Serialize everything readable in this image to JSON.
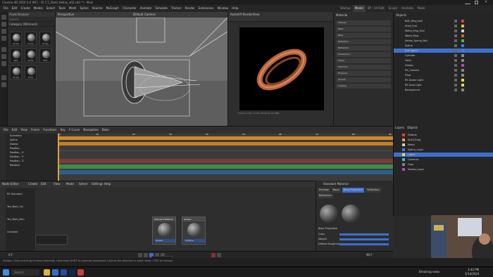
{
  "window": {
    "title": "Cinema 4D 2024.4.0 (RC) - [R 1.5_Shell_Helios_v02.c4d *] - Main"
  },
  "menu": [
    "File",
    "Edit",
    "Create",
    "Modes",
    "Select",
    "Tools",
    "Mesh",
    "Spline",
    "Volume",
    "MoGraph",
    "Character",
    "Animate",
    "Simulate",
    "Tracker",
    "Render",
    "Extensions",
    "Window",
    "Help"
  ],
  "modes": {
    "items": [
      "Startup",
      "Model",
      "BP - UV Edit",
      "Sculpt",
      "Animate",
      "Node"
    ],
    "active": "Model"
  },
  "asset_browser": {
    "title": "Asset Browser",
    "search_placeholder": "Search",
    "category": "Category (Wildcard)",
    "items": [
      "Screw",
      "Screw",
      "Hinge",
      "Nail",
      "Screw",
      "Bolt",
      "Screw",
      "Knob"
    ]
  },
  "viewport": {
    "label": "Perspective",
    "camera": "Default Camera"
  },
  "render_view": {
    "title": "Redshift RenderView",
    "status": "Frame: 0  2K1 / 8 48 / 00:00:02 (0.1MB)"
  },
  "material_attributes": {
    "title": "Material",
    "rows": [
      "Preview",
      "Basic",
      "Base",
      "Reflection",
      "Refraction",
      "Subsurface",
      "Sheen",
      "Thin Film",
      "Emission",
      "Overall",
      "Coating"
    ]
  },
  "object_manager": {
    "title": "Objects",
    "rows": [
      {
        "name": "Bolt_Ring_Null",
        "tag": "#e04040"
      },
      {
        "name": "Shell_Sub",
        "tag": "#e0c040"
      },
      {
        "name": "Metal_Ring_Null",
        "tag": "#d0d0d0"
      },
      {
        "name": "Wood_Ring",
        "tag": "#c07030"
      },
      {
        "name": "Helios_Spring_Null",
        "tag": "#40c040"
      },
      {
        "name": "Spline",
        "tag": "#4080e0"
      },
      {
        "name": "Sub Spline",
        "tag": "#4080e0"
      },
      {
        "name": "Cylinder",
        "tag": "#888888"
      },
      {
        "name": "Helix",
        "tag": "#888888"
      },
      {
        "name": "Sweep",
        "tag": "#c040c0"
      },
      {
        "name": "RS_Camera",
        "tag": "#888888"
      },
      {
        "name": "Floor",
        "tag": "#888888"
      },
      {
        "name": "RS Dome Light",
        "tag": "#e0e040"
      },
      {
        "name": "RS Area Light",
        "tag": "#e0e040"
      },
      {
        "name": "Background",
        "tag": "#888888"
      }
    ]
  },
  "timeline": {
    "title": "Timeline",
    "menu": [
      "File",
      "Edit",
      "View",
      "Frame",
      "Functions",
      "Key",
      "F-Curve",
      "Navigation",
      "Bake"
    ],
    "tracks": [
      "Summary",
      "Spline",
      "Sweep",
      "Position",
      "Position . X",
      "Position . Y",
      "Position . Z",
      "Rotation"
    ],
    "ruler": [
      "0",
      "10",
      "20",
      "30",
      "40",
      "50",
      "60",
      "70",
      "80",
      "90"
    ]
  },
  "node_editor": {
    "title": "Node Editor",
    "menu": [
      "Create",
      "Edit",
      "View",
      "Mode",
      "Select",
      "Settings",
      "Help"
    ],
    "nodes": [
      {
        "title": "Standard Material",
        "out": "Output"
      },
      {
        "title": "Output",
        "out": "Surface"
      }
    ],
    "side_labels": [
      "RS Standard",
      "Tex_Bark_Col",
      "Tex_Bark_Nrm",
      "Unlinked"
    ]
  },
  "material_preview": {
    "title": "Standard Material",
    "tabs": [
      "Preview",
      "Basic",
      "Base Properties",
      "Reflection",
      "Refraction"
    ],
    "section": "Base Properties",
    "fields": [
      "Color",
      "Weight",
      "Diffuse Roughness"
    ]
  },
  "layers": {
    "tabs": [
      "Layers",
      "Objects"
    ],
    "rows": [
      {
        "name": "Default",
        "color": "#e04040"
      },
      {
        "name": "Shell_Ring",
        "color": "#e0a040"
      },
      {
        "name": "Metal",
        "color": "#d0d0d0"
      },
      {
        "name": "Spline_Layer",
        "color": "#4080e0"
      },
      {
        "name": "Lights",
        "color": "#e0e040"
      },
      {
        "name": "Cameras",
        "color": "#40c0c0"
      },
      {
        "name": "Floor",
        "color": "#808080"
      },
      {
        "name": "Sweep_Layer",
        "color": "#c040c0"
      }
    ]
  },
  "playback": {
    "current_frame": "0 F",
    "end_frame": "90 F",
    "tooltip_title": "Play forwards",
    "tooltip_shortcut": "F8 / Ctrl+F"
  },
  "status_line": "Position: Click and drag to move elements. Hold down SHIFT to quantize movement / add to the selection in point mode, CTRL to remove.",
  "taskbar": {
    "search": "Search",
    "weather": "Breaking news",
    "time": "3:42 PM",
    "date": "3/14/2024"
  },
  "colors": {
    "accent": "#3d6fcf",
    "orange_track": "#d08a2a",
    "green_track": "#3c8c4c"
  }
}
